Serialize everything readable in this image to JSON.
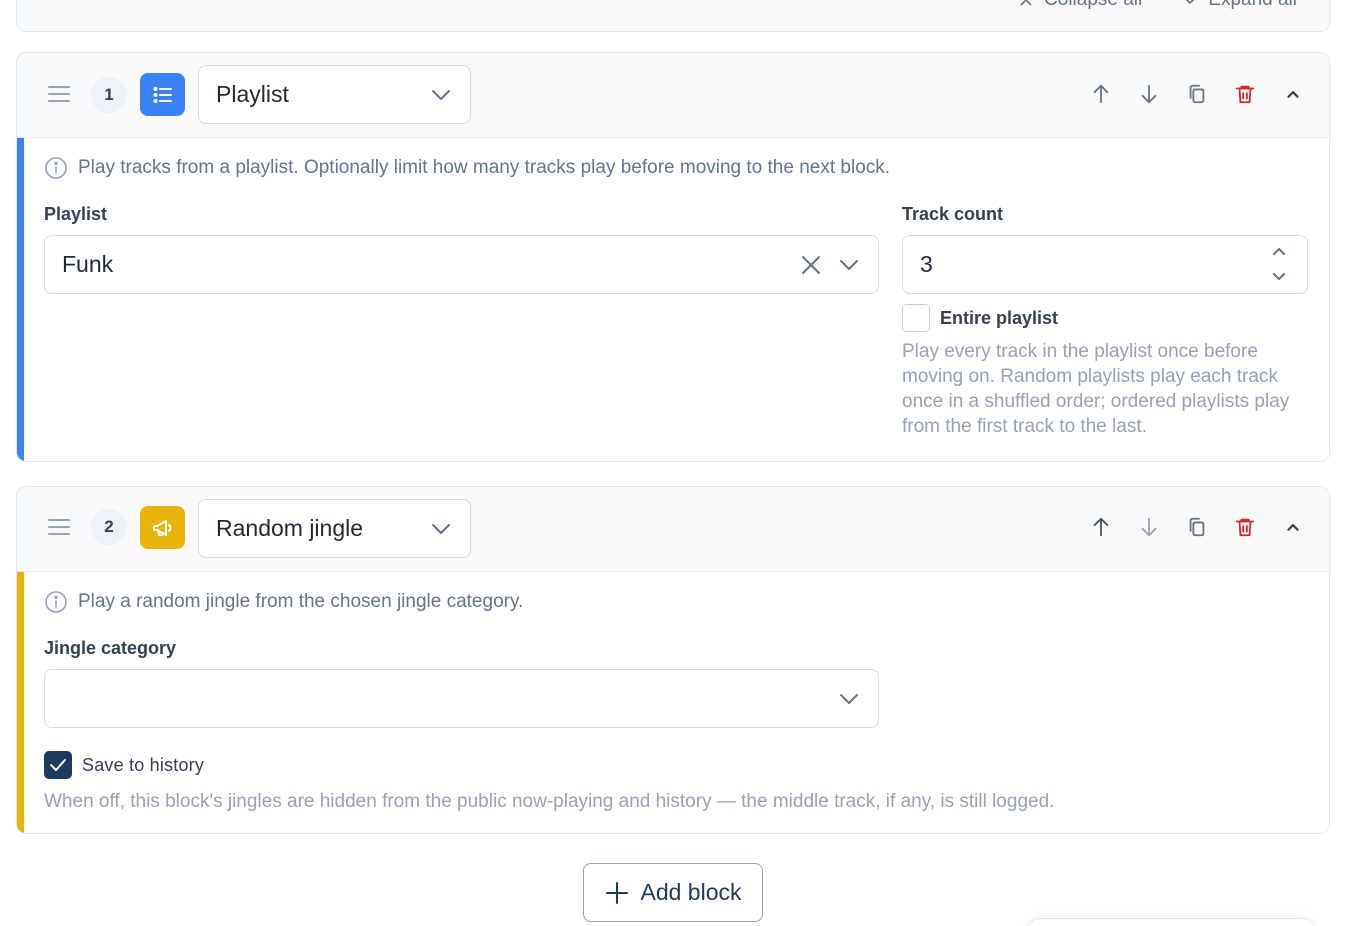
{
  "toolbar": {
    "collapse_all": "Collapse all",
    "expand_all": "Expand all"
  },
  "blocks": [
    {
      "number": "1",
      "type": "Playlist",
      "accent_color": "#3b82f6",
      "icon": "list-icon",
      "description": "Play tracks from a playlist. Optionally limit how many tracks play before moving to the next block.",
      "playlist_label": "Playlist",
      "playlist_value": "Funk",
      "track_count_label": "Track count",
      "track_count_value": "3",
      "entire_playlist_label": "Entire playlist",
      "entire_playlist_checked": false,
      "entire_playlist_help": "Play every track in the playlist once before moving on. Random playlists play each track once in a shuffled order; ordered playlists play from the first track to the last."
    },
    {
      "number": "2",
      "type": "Random jingle",
      "accent_color": "#eab308",
      "icon": "megaphone-icon",
      "description": "Play a random jingle from the chosen jingle category.",
      "jingle_category_label": "Jingle category",
      "jingle_category_value": "",
      "save_history_label": "Save to history",
      "save_history_checked": true,
      "save_history_help": "When off, this block's jingles are hidden from the public now-playing and history — the middle track, if any, is still logged."
    }
  ],
  "add_block_label": "Add block"
}
